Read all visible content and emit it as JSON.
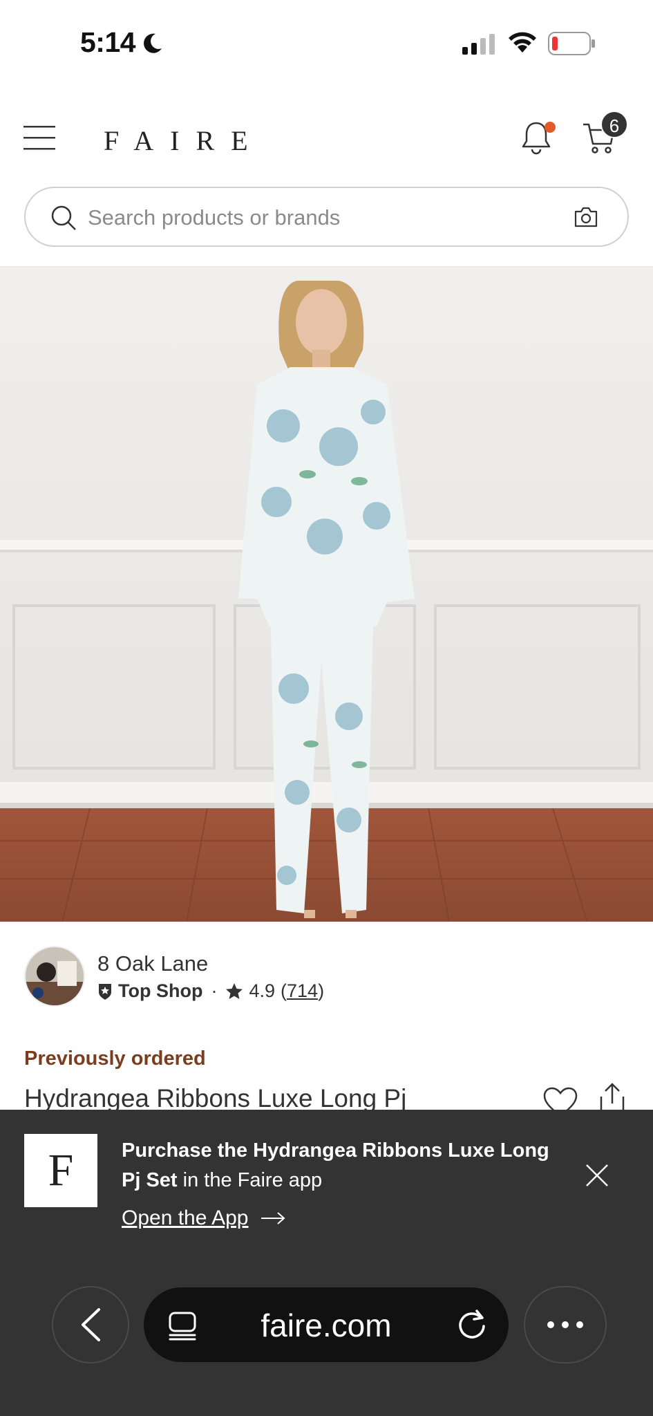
{
  "status_bar": {
    "time": "5:14"
  },
  "header": {
    "logo": "FAIRE",
    "cart_count": "6"
  },
  "search": {
    "placeholder": "Search products or brands"
  },
  "shop": {
    "name": "8 Oak Lane",
    "badge": "Top Shop",
    "separator": "·",
    "rating": "4.9",
    "reviews": "714"
  },
  "product": {
    "status": "Previously ordered",
    "title": "Hydrangea Ribbons Luxe Long Pj"
  },
  "banner": {
    "logo_letter": "F",
    "text_bold": "Purchase the Hydrangea Ribbons Luxe Long Pj Set",
    "text_rest": " in the Faire app",
    "cta": "Open the App"
  },
  "browser": {
    "url": "faire.com"
  },
  "colors": {
    "accent_brown": "#7a3e1e",
    "notification_dot": "#e25a28",
    "banner_bg": "#333333"
  }
}
